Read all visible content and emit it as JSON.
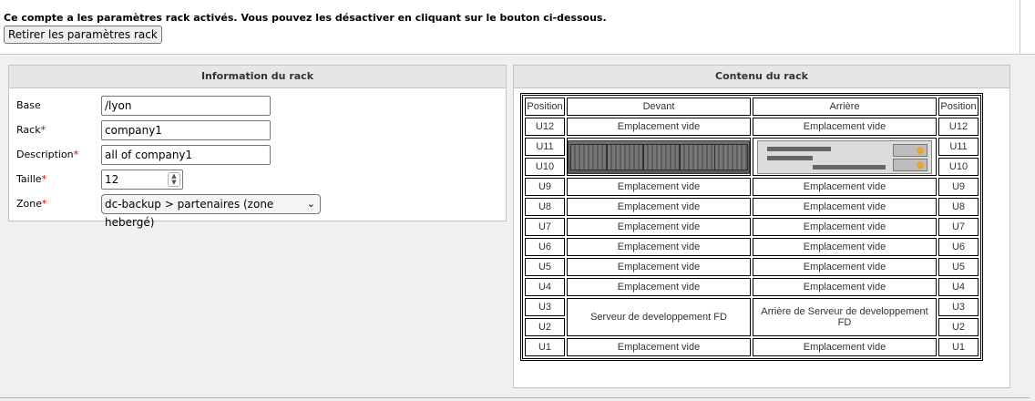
{
  "notice": "Ce compte a les paramètres rack activés. Vous pouvez les désactiver en cliquant sur le bouton ci-dessous.",
  "remove_button": "Retirer les paramètres rack",
  "info_panel": {
    "title": "Information du rack",
    "fields": {
      "base": {
        "label": "Base",
        "value": "/lyon"
      },
      "rack": {
        "label": "Rack",
        "value": "company1",
        "required": "*"
      },
      "description": {
        "label": "Description",
        "value": "all of company1",
        "required": "*"
      },
      "taille": {
        "label": "Taille",
        "value": "12",
        "required": "*"
      },
      "zone": {
        "label": "Zone",
        "value": "dc-backup > partenaires (zone hebergé)",
        "required": "*"
      }
    }
  },
  "contenu_panel": {
    "title": "Contenu du rack",
    "headers": {
      "position": "Position",
      "front": "Devant",
      "back": "Arrière"
    },
    "rows": [
      {
        "pos": "U12",
        "front": "Emplacement vide",
        "back": "Emplacement vide"
      },
      {
        "pos": "U11"
      },
      {
        "pos": "U10"
      },
      {
        "pos": "U9",
        "front": "Emplacement vide",
        "back": "Emplacement vide"
      },
      {
        "pos": "U8",
        "front": "Emplacement vide",
        "back": "Emplacement vide"
      },
      {
        "pos": "U7",
        "front": "Emplacement vide",
        "back": "Emplacement vide"
      },
      {
        "pos": "U6",
        "front": "Emplacement vide",
        "back": "Emplacement vide"
      },
      {
        "pos": "U5",
        "front": "Emplacement vide",
        "back": "Emplacement vide"
      },
      {
        "pos": "U4",
        "front": "Emplacement vide",
        "back": "Emplacement vide"
      },
      {
        "pos": "U3",
        "front": "Serveur de developpement FD",
        "back": "Arrière de Serveur de developpement FD"
      },
      {
        "pos": "U2"
      },
      {
        "pos": "U1",
        "front": "Emplacement vide",
        "back": "Emplacement vide"
      }
    ],
    "server_images": {
      "front": "server-front-image",
      "back": "server-back-image"
    }
  }
}
